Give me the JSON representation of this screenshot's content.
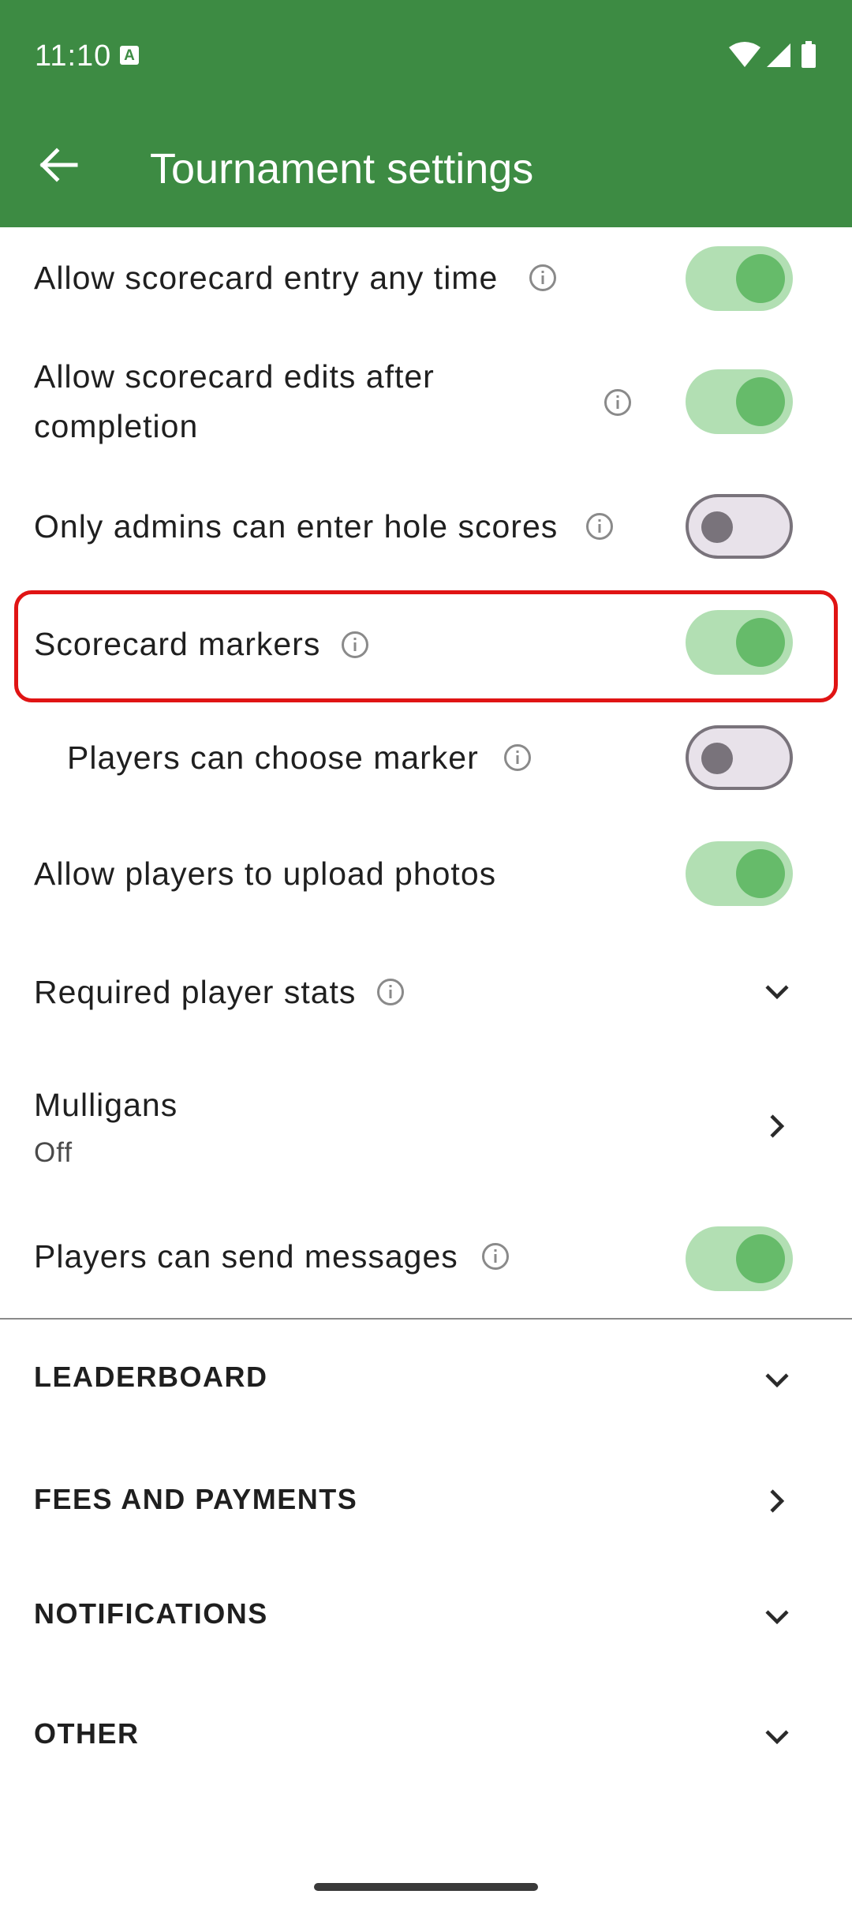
{
  "status_bar": {
    "time": "11:10",
    "notification_icon": "a-icon"
  },
  "app_bar": {
    "title": "Tournament settings",
    "back_icon": "arrow-left-icon"
  },
  "settings": [
    {
      "label": "Allow scorecard entry any time",
      "info": true,
      "toggle": "on"
    },
    {
      "label_line1": "Allow scorecard edits after",
      "label_line2": "completion",
      "info": true,
      "toggle": "on"
    },
    {
      "label": "Only admins can enter hole scores",
      "info": true,
      "toggle": "off"
    },
    {
      "label": "Scorecard markers",
      "info": true,
      "toggle": "on",
      "highlighted": true
    },
    {
      "label": "Players can choose marker",
      "info": true,
      "toggle": "off"
    },
    {
      "label": "Allow players to upload photos",
      "info": false,
      "toggle": "on"
    },
    {
      "label": "Required player stats",
      "info": true,
      "control": "chevron-down"
    },
    {
      "label": "Mulligans",
      "value": "Off",
      "control": "chevron-right"
    },
    {
      "label": "Players can send messages",
      "info": true,
      "toggle": "on"
    }
  ],
  "sections": [
    {
      "label": "LEADERBOARD",
      "control": "chevron-down"
    },
    {
      "label": "FEES AND PAYMENTS",
      "control": "chevron-right"
    },
    {
      "label": "NOTIFICATIONS",
      "control": "chevron-down"
    },
    {
      "label": "OTHER",
      "control": "chevron-down"
    }
  ],
  "colors": {
    "primary": "#3d8b43",
    "toggle_on_track": "#b2dfb3",
    "toggle_on_knob": "#66bb6a",
    "highlight": "#e01414"
  }
}
